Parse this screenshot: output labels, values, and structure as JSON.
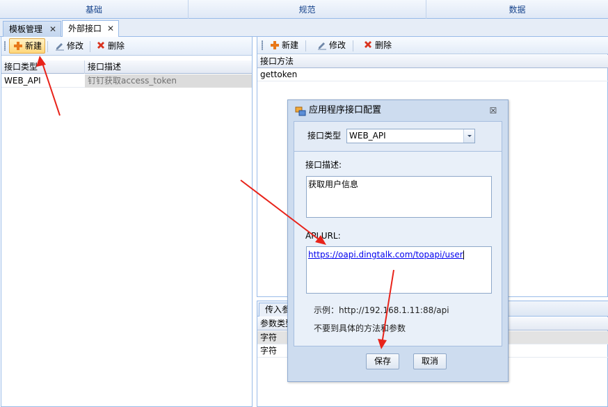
{
  "top_tabs": [
    "基础",
    "规范",
    "数据"
  ],
  "doc_tabs": [
    {
      "label": "模板管理",
      "close": "✕"
    },
    {
      "label": "外部接口",
      "close": "✕"
    }
  ],
  "left_toolbar": {
    "new": "新建",
    "edit": "修改",
    "delete": "删除"
  },
  "left_grid": {
    "columns": [
      "接口类型",
      "接口描述"
    ],
    "rows": [
      [
        "WEB_API",
        "钉钉获取access_token"
      ]
    ]
  },
  "right_toolbar": {
    "new": "新建",
    "edit": "修改",
    "delete": "删除"
  },
  "method_grid": {
    "columns": [
      "接口方法"
    ],
    "rows": [
      [
        "gettoken"
      ]
    ]
  },
  "params_panel": {
    "tab_label": "传入参",
    "columns": [
      "参数类型"
    ],
    "rows": [
      [
        "字符"
      ],
      [
        "字符"
      ]
    ]
  },
  "dialog": {
    "title": "应用程序接口配置",
    "close": "☒",
    "type_label": "接口类型",
    "type_value": "WEB_API",
    "desc_label": "接口描述:",
    "desc_value": "获取用户信息",
    "url_label": "API URL:",
    "url_value": "https://oapi.dingtalk.com/topapi/user",
    "example_text": "示例：http://192.168.1.11:88/api",
    "note_text": "不要到具体的方法和参数",
    "save": "保存",
    "cancel": "取消"
  },
  "colors": {
    "accent_border": "#99bbe8",
    "tab_text": "#15428b",
    "arrow": "#e8231a",
    "link": "#0000ee"
  }
}
